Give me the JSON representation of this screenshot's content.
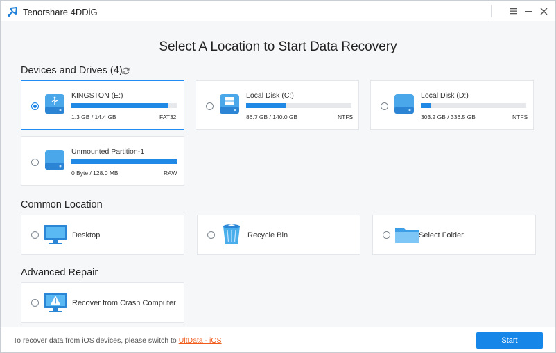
{
  "app": {
    "title": "Tenorshare 4DDiG"
  },
  "page_title": "Select A Location to Start Data Recovery",
  "sections": {
    "devices": "Devices and Drives (4)",
    "common": "Common Location",
    "advanced": "Advanced Repair"
  },
  "drives": [
    {
      "name": "KINGSTON (E:)",
      "size": "1.3 GB / 14.4 GB",
      "fs": "FAT32",
      "used": 0.92,
      "selected": true,
      "icon": "usb-drive-icon"
    },
    {
      "name": "Local Disk (C:)",
      "size": "86.7 GB / 140.0 GB",
      "fs": "NTFS",
      "used": 0.38,
      "selected": false,
      "icon": "windows-drive-icon"
    },
    {
      "name": "Local Disk (D:)",
      "size": "303.2 GB / 336.5 GB",
      "fs": "NTFS",
      "used": 0.09,
      "selected": false,
      "icon": "hard-drive-icon"
    },
    {
      "name": "Unmounted Partition-1",
      "size": "0 Byte / 128.0 MB",
      "fs": "RAW",
      "used": 1.0,
      "selected": false,
      "icon": "hard-drive-icon"
    }
  ],
  "locations": [
    {
      "label": "Desktop",
      "icon": "desktop-icon"
    },
    {
      "label": "Recycle Bin",
      "icon": "recycle-bin-icon"
    },
    {
      "label": "Select Folder",
      "icon": "folder-icon"
    }
  ],
  "advanced_items": [
    {
      "label": "Recover from Crash Computer",
      "icon": "crash-computer-icon"
    }
  ],
  "footer": {
    "text": "To recover data from iOS devices, please switch to ",
    "link": "UltData - iOS",
    "start_label": "Start"
  },
  "colors": {
    "accent": "#1687e8",
    "link": "#f05a1a",
    "bar_fill": "#1f89e5",
    "bar_track": "#e6e8eb"
  }
}
